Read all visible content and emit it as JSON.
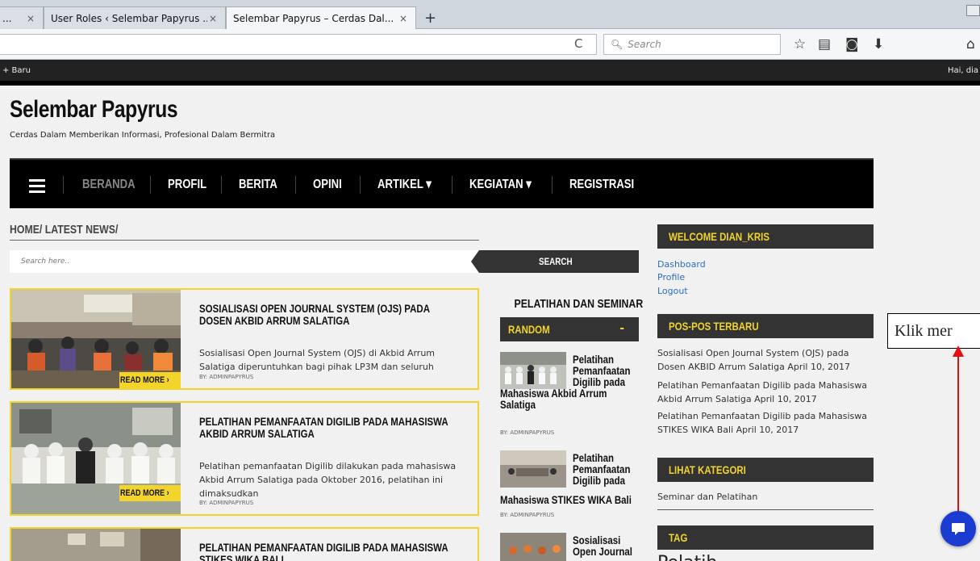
{
  "browser": {
    "tabs": [
      {
        "label": "...",
        "active": false
      },
      {
        "label": "User Roles ‹ Selembar Papyrus ...",
        "active": false
      },
      {
        "label": "Selembar Papyrus – Cerdas Dal...",
        "active": true
      }
    ],
    "close_glyph": "×",
    "new_tab_glyph": "+",
    "search_placeholder": "Search",
    "reload_glyph": "C"
  },
  "admin_bar": {
    "new_label": "+ Baru",
    "greeting": "Hai, dia"
  },
  "site": {
    "title": "Selembar Papyrus",
    "tagline": "Cerdas Dalam Memberikan Informasi, Profesional Dalam Bermitra"
  },
  "nav": {
    "items": [
      {
        "label": "BERANDA",
        "current": true
      },
      {
        "label": "PROFIL",
        "current": false
      },
      {
        "label": "BERITA",
        "current": false
      },
      {
        "label": "OPINI",
        "current": false
      },
      {
        "label": "ARTIKEL ▾",
        "current": false
      },
      {
        "label": "KEGIATAN ▾",
        "current": false
      },
      {
        "label": "REGISTRASI",
        "current": false
      }
    ]
  },
  "breadcrumb": "HOME/ LATEST NEWS/",
  "search": {
    "placeholder": "Search here..",
    "button": "SEARCH"
  },
  "articles": [
    {
      "title": "SOSIALISASI OPEN JOURNAL SYSTEM (OJS) PADA DOSEN AKBID ARRUM SALATIGA",
      "excerpt": "Sosialisasi Open Journal System (OJS) di Akbid Arrum Salatiga diperuntuhkan bagi pihak LP3M dan seluruh",
      "byline": "BY: ADMINPAPYRUS",
      "read_more": "READ MORE ›"
    },
    {
      "title": "PELATIHAN PEMANFAATAN DIGILIB PADA MAHASISWA AKBID ARRUM SALATIGA",
      "excerpt": "Pelatihan pemanfaatan Digilib dilakukan pada mahasiswa Akbid Arrum Salatiga pada Oktober 2016, pelatihan ini dimaksudkan",
      "byline": "BY: ADMINPAPYRUS",
      "read_more": "READ MORE ›"
    },
    {
      "title": "PELATIHAN PEMANFAATAN DIGILIB PADA MAHASISWA STIKES WIKA BALI",
      "excerpt": "",
      "byline": "",
      "read_more": ""
    }
  ],
  "middle": {
    "heading": "PELATIHAN DAN SEMINAR",
    "random_label": "RANDOM",
    "random_toggle": "-",
    "posts": [
      {
        "title_right": "Pelatihan Pemanfaatan Digilib pada",
        "title_full": "Mahasiswa Akbid Arrum Salatiga",
        "byline": "BY: ADMINPAPYRUS"
      },
      {
        "title_right": "Pelatihan Pemanfaatan Digilib pada",
        "title_full": "Mahasiswa STIKES WIKA Bali",
        "byline": "BY: ADMINPAPYRUS"
      },
      {
        "title_right": "Sosialisasi Open Journal",
        "title_full": "",
        "byline": ""
      }
    ]
  },
  "sidebar": {
    "welcome_title": "WELCOME DIAN_KRIS",
    "links": [
      "Dashboard",
      "Profile",
      "Logout"
    ],
    "recent_title": "POS-POS TERBARU",
    "recent_posts": [
      "Sosialisasi Open Journal System (OJS) pada Dosen AKBID Arrum Salatiga April 10, 2017",
      "Pelatihan Pemanfaatan Digilib pada Mahasiswa Akbid Arrum Salatiga April 10, 2017",
      "Pelatihan Pemanfaatan Digilib pada Mahasiswa STIKES WIKA Bali April 10, 2017"
    ],
    "category_title": "LIHAT KATEGORI",
    "categories": [
      "Seminar dan Pelatihan"
    ],
    "tag_title": "TAG",
    "tag_partial": "Pelatih"
  },
  "annotation": {
    "callout_text": "Klik mer"
  },
  "colors": {
    "accent": "#f2d42a",
    "nav_bg": "#000000",
    "link": "#2a6fc2",
    "chat": "#1b3bd1",
    "arrow": "#e01010"
  }
}
